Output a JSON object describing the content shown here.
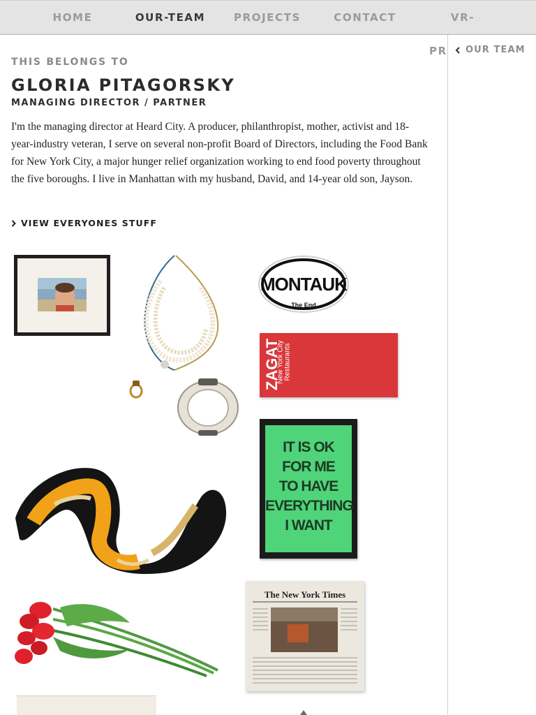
{
  "nav": {
    "items": [
      {
        "label": "HOME",
        "active": false
      },
      {
        "label": "OUR-TEAM",
        "active": true
      },
      {
        "label": "PROJECTS",
        "active": false
      },
      {
        "label": "CONTACT",
        "active": false
      },
      {
        "label": "VR-PROJECTS",
        "active": false
      }
    ]
  },
  "sidebar": {
    "back_label": "OUR TEAM",
    "back_icon": "chevron-left-icon"
  },
  "profile": {
    "belongs_label": "THIS BELONGS TO",
    "name": "GLORIA PITAGORSKY",
    "role": "MANAGING DIRECTOR / PARTNER",
    "bio": "I'm the managing director at Heard City. A producer, philanthropist, mother, activist and 18-year-industry veteran, I serve on several non-profit Board of Directors, including the Food Bank for New York City, a major hunger relief organization working to end food poverty throughout the five boroughs. I live in Manhattan with my husband, David, and 14-year old son, Jayson.",
    "view_all_label": "VIEW EVERYONES STUFF",
    "view_all_icon": "chevron-right-icon"
  },
  "items": {
    "sticker_text": "MONTAUK",
    "sticker_subtext": "The End",
    "guide_brand": "ZAGAT",
    "guide_line1": "New York City",
    "guide_line2": "Restaurants",
    "poster_lines": [
      "IT IS OK",
      "FOR ME",
      "TO HAVE",
      "EVERYTHING",
      "I WANT"
    ],
    "newspaper_masthead": "The New York Times"
  },
  "colors": {
    "nav_bg": "#e4e4e5",
    "nav_active": "#3a3a3a",
    "nav_inactive": "#9a9a9a",
    "zagat_red": "#d9373a",
    "poster_green": "#4fd47a"
  }
}
